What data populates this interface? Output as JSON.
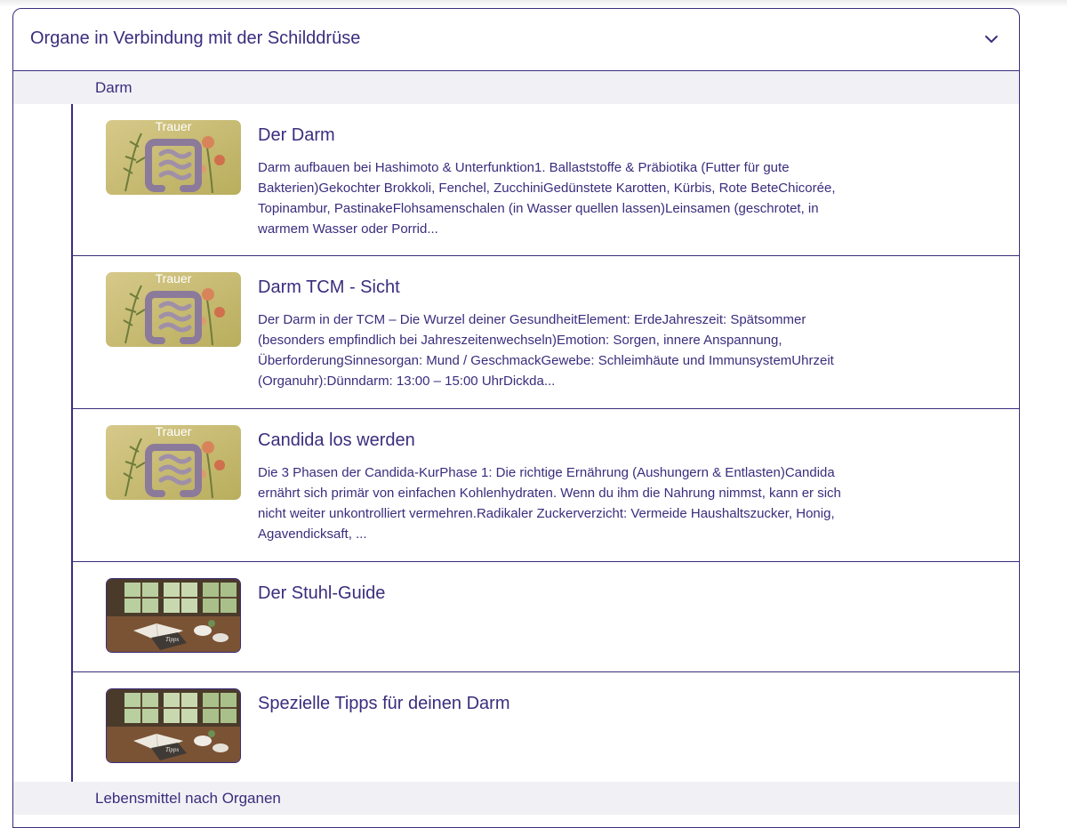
{
  "accordion": {
    "title": "Organe in Verbindung mit der Schilddrüse",
    "toggle_icon": "chevron-down-icon"
  },
  "groups": {
    "darm": "Darm",
    "lebensmittel": "Lebensmittel nach Organen"
  },
  "thumb_text": {
    "trauer": "Trauer",
    "tipps": "Tipps"
  },
  "items": [
    {
      "title": "Der Darm",
      "description": "Darm aufbauen bei Hashimoto & Unterfunktion1. Ballaststoffe & Präbiotika (Futter für gute Bakterien)Gekochter Brokkoli, Fenchel, ZucchiniGedünstete Karotten, Kürbis, Rote BeteChicorée, Topinambur, PastinakeFlohsamenschalen (in Wasser quellen lassen)Leinsamen (geschrotet, in warmem Wasser oder Porrid...",
      "thumbnail": "intestine-illustration"
    },
    {
      "title": "Darm TCM - Sicht",
      "description": "Der Darm in der TCM – Die Wurzel deiner GesundheitElement: ErdeJahreszeit: Spätsommer (besonders empfindlich bei Jahreszeitenwechseln)Emotion: Sorgen, innere Anspannung, ÜberforderungSinnesorgan: Mund / GeschmackGewebe: Schleimhäute und ImmunsystemUhrzeit (Organuhr):Dünndarm: 13:00 – 15:00 UhrDickda...",
      "thumbnail": "intestine-illustration"
    },
    {
      "title": "Candida los werden",
      "description": "Die 3 Phasen der Candida-KurPhase 1: Die richtige Ernährung (Aushungern & Entlasten)Candida ernährt sich primär von einfachen Kohlenhydraten. Wenn du ihm die Nahrung nimmst, kann er sich nicht weiter unkontrolliert vermehren.Radikaler Zuckerverzicht: Vermeide Haushaltszucker, Honig, Agavendicksaft, ...",
      "thumbnail": "intestine-illustration"
    },
    {
      "title": "Der Stuhl-Guide",
      "description": "",
      "thumbnail": "book-on-table-photo"
    },
    {
      "title": "Spezielle Tipps für deinen Darm",
      "description": "",
      "thumbnail": "book-on-table-photo"
    }
  ],
  "colors": {
    "primary": "#3a2d7d",
    "group_bg": "#f1f1f5",
    "thumb_bg": "#c7b96a"
  }
}
